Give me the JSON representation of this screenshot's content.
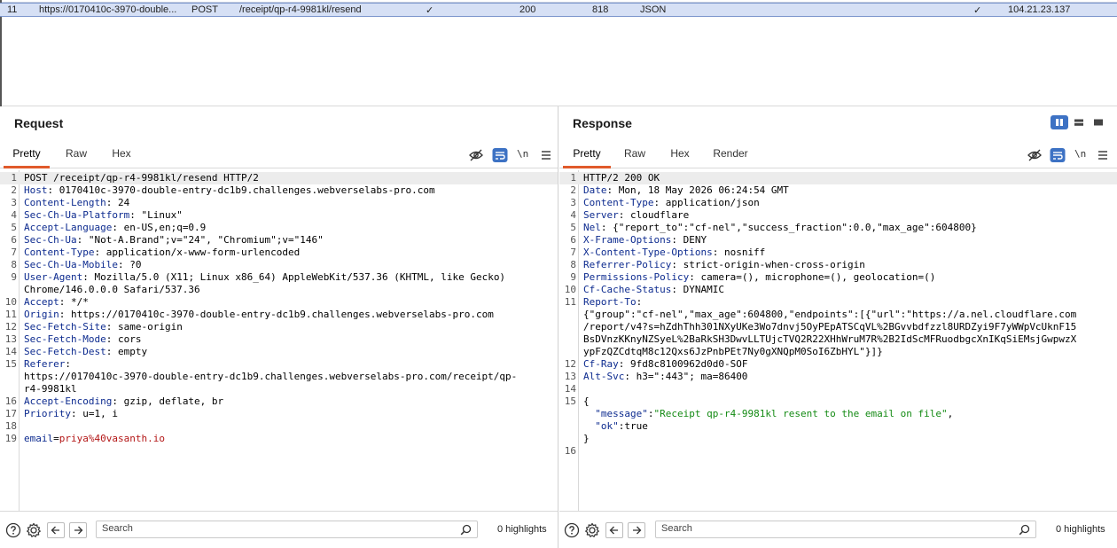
{
  "history": {
    "row": {
      "num": "11",
      "host": "https://0170410c-3970-double...",
      "method": "POST",
      "url": "/receipt/qp-r4-9981kl/resend",
      "params_check": "✓",
      "status": "200",
      "length": "818",
      "mime": "JSON",
      "tls_check": "✓",
      "ip": "104.21.23.137"
    }
  },
  "request": {
    "title": "Request",
    "tabs": [
      "Pretty",
      "Raw",
      "Hex"
    ],
    "newline_label": "\\n",
    "search_placeholder": "Search",
    "highlights": "0 highlights",
    "lines": [
      {
        "n": "1",
        "segs": [
          {
            "t": "POST /receipt/qp-r4-9981kl/resend HTTP/2",
            "c": "v"
          }
        ],
        "hl": true
      },
      {
        "n": "2",
        "segs": [
          {
            "t": "Host",
            "c": "k"
          },
          {
            "t": ": 0170410c-3970-double-entry-dc1b9.challenges.webverselabs-pro.com",
            "c": "v"
          }
        ]
      },
      {
        "n": "3",
        "segs": [
          {
            "t": "Content-Length",
            "c": "k"
          },
          {
            "t": ": 24",
            "c": "v"
          }
        ]
      },
      {
        "n": "4",
        "segs": [
          {
            "t": "Sec-Ch-Ua-Platform",
            "c": "k"
          },
          {
            "t": ": \"Linux\"",
            "c": "v"
          }
        ]
      },
      {
        "n": "5",
        "segs": [
          {
            "t": "Accept-Language",
            "c": "k"
          },
          {
            "t": ": en-US,en;q=0.9",
            "c": "v"
          }
        ]
      },
      {
        "n": "6",
        "segs": [
          {
            "t": "Sec-Ch-Ua",
            "c": "k"
          },
          {
            "t": ": \"Not-A.Brand\";v=\"24\", \"Chromium\";v=\"146\"",
            "c": "v"
          }
        ]
      },
      {
        "n": "7",
        "segs": [
          {
            "t": "Content-Type",
            "c": "k"
          },
          {
            "t": ": application/x-www-form-urlencoded",
            "c": "v"
          }
        ]
      },
      {
        "n": "8",
        "segs": [
          {
            "t": "Sec-Ch-Ua-Mobile",
            "c": "k"
          },
          {
            "t": ": ?0",
            "c": "v"
          }
        ]
      },
      {
        "n": "9",
        "segs": [
          {
            "t": "User-Agent",
            "c": "k"
          },
          {
            "t": ": Mozilla/5.0 (X11; Linux x86_64) AppleWebKit/537.36 (KHTML, like Gecko)",
            "c": "v"
          }
        ]
      },
      {
        "n": "",
        "segs": [
          {
            "t": "Chrome/146.0.0.0 Safari/537.36",
            "c": "v"
          }
        ]
      },
      {
        "n": "10",
        "segs": [
          {
            "t": "Accept",
            "c": "k"
          },
          {
            "t": ": */*",
            "c": "v"
          }
        ]
      },
      {
        "n": "11",
        "segs": [
          {
            "t": "Origin",
            "c": "k"
          },
          {
            "t": ": https://0170410c-3970-double-entry-dc1b9.challenges.webverselabs-pro.com",
            "c": "v"
          }
        ]
      },
      {
        "n": "12",
        "segs": [
          {
            "t": "Sec-Fetch-Site",
            "c": "k"
          },
          {
            "t": ": same-origin",
            "c": "v"
          }
        ]
      },
      {
        "n": "13",
        "segs": [
          {
            "t": "Sec-Fetch-Mode",
            "c": "k"
          },
          {
            "t": ": cors",
            "c": "v"
          }
        ]
      },
      {
        "n": "14",
        "segs": [
          {
            "t": "Sec-Fetch-Dest",
            "c": "k"
          },
          {
            "t": ": empty",
            "c": "v"
          }
        ]
      },
      {
        "n": "15",
        "segs": [
          {
            "t": "Referer",
            "c": "k"
          },
          {
            "t": ":",
            "c": "v"
          }
        ]
      },
      {
        "n": "",
        "segs": [
          {
            "t": "https://0170410c-3970-double-entry-dc1b9.challenges.webverselabs-pro.com/receipt/qp-",
            "c": "v"
          }
        ]
      },
      {
        "n": "",
        "segs": [
          {
            "t": "r4-9981kl",
            "c": "v"
          }
        ]
      },
      {
        "n": "16",
        "segs": [
          {
            "t": "Accept-Encoding",
            "c": "k"
          },
          {
            "t": ": gzip, deflate, br",
            "c": "v"
          }
        ]
      },
      {
        "n": "17",
        "segs": [
          {
            "t": "Priority",
            "c": "k"
          },
          {
            "t": ": u=1, i",
            "c": "v"
          }
        ]
      },
      {
        "n": "18",
        "segs": []
      },
      {
        "n": "19",
        "segs": [
          {
            "t": "email",
            "c": "k"
          },
          {
            "t": "=",
            "c": "v"
          },
          {
            "t": "priya%40vasanth.io",
            "c": "bv"
          }
        ]
      }
    ]
  },
  "response": {
    "title": "Response",
    "tabs": [
      "Pretty",
      "Raw",
      "Hex",
      "Render"
    ],
    "newline_label": "\\n",
    "search_placeholder": "Search",
    "highlights": "0 highlights",
    "lines": [
      {
        "n": "1",
        "segs": [
          {
            "t": "HTTP/2 200 OK",
            "c": "v"
          }
        ],
        "hl": true
      },
      {
        "n": "2",
        "segs": [
          {
            "t": "Date",
            "c": "k"
          },
          {
            "t": ": Mon, 18 May 2026 06:24:54 GMT",
            "c": "v"
          }
        ]
      },
      {
        "n": "3",
        "segs": [
          {
            "t": "Content-Type",
            "c": "k"
          },
          {
            "t": ": application/json",
            "c": "v"
          }
        ]
      },
      {
        "n": "4",
        "segs": [
          {
            "t": "Server",
            "c": "k"
          },
          {
            "t": ": cloudflare",
            "c": "v"
          }
        ]
      },
      {
        "n": "5",
        "segs": [
          {
            "t": "Nel",
            "c": "k"
          },
          {
            "t": ": {\"report_to\":\"cf-nel\",\"success_fraction\":0.0,\"max_age\":604800}",
            "c": "v"
          }
        ]
      },
      {
        "n": "6",
        "segs": [
          {
            "t": "X-Frame-Options",
            "c": "k"
          },
          {
            "t": ": DENY",
            "c": "v"
          }
        ]
      },
      {
        "n": "7",
        "segs": [
          {
            "t": "X-Content-Type-Options",
            "c": "k"
          },
          {
            "t": ": nosniff",
            "c": "v"
          }
        ]
      },
      {
        "n": "8",
        "segs": [
          {
            "t": "Referrer-Policy",
            "c": "k"
          },
          {
            "t": ": strict-origin-when-cross-origin",
            "c": "v"
          }
        ]
      },
      {
        "n": "9",
        "segs": [
          {
            "t": "Permissions-Policy",
            "c": "k"
          },
          {
            "t": ": camera=(), microphone=(), geolocation=()",
            "c": "v"
          }
        ]
      },
      {
        "n": "10",
        "segs": [
          {
            "t": "Cf-Cache-Status",
            "c": "k"
          },
          {
            "t": ": DYNAMIC",
            "c": "v"
          }
        ]
      },
      {
        "n": "11",
        "segs": [
          {
            "t": "Report-To",
            "c": "k"
          },
          {
            "t": ":",
            "c": "v"
          }
        ]
      },
      {
        "n": "",
        "segs": [
          {
            "t": "{\"group\":\"cf-nel\",\"max_age\":604800,\"endpoints\":[{\"url\":\"https://a.nel.cloudflare.com",
            "c": "v"
          }
        ]
      },
      {
        "n": "",
        "segs": [
          {
            "t": "/report/v4?s=hZdhThh301NXyUKe3Wo7dnvj5OyPEpATSCqVL%2BGvvbdfzzl8URDZyi9F7yWWpVcUknF15",
            "c": "v"
          }
        ]
      },
      {
        "n": "",
        "segs": [
          {
            "t": "BsDVnzKKnyNZSyeL%2BaRkSH3DwvLLTUjcTVQ2R22XHhWruM7R%2B2IdScMFRuodbgcXnIKqSiEMsjGwpwzX",
            "c": "v"
          }
        ]
      },
      {
        "n": "",
        "segs": [
          {
            "t": "ypFzQZCdtqM8c12Qxs6JzPnbPEt7Ny0gXNQpM0SoI6ZbHYL\"}]}",
            "c": "v"
          }
        ]
      },
      {
        "n": "12",
        "segs": [
          {
            "t": "Cf-Ray",
            "c": "k"
          },
          {
            "t": ": 9fd8c8100962d0d0-SOF",
            "c": "v"
          }
        ]
      },
      {
        "n": "13",
        "segs": [
          {
            "t": "Alt-Svc",
            "c": "k"
          },
          {
            "t": ": h3=\":443\"; ma=86400",
            "c": "v"
          }
        ]
      },
      {
        "n": "14",
        "segs": []
      },
      {
        "n": "15",
        "segs": [
          {
            "t": "{",
            "c": "v"
          }
        ]
      },
      {
        "n": "",
        "segs": [
          {
            "t": "  \"message\"",
            "c": "js"
          },
          {
            "t": ":",
            "c": "v"
          },
          {
            "t": "\"Receipt qp-r4-9981kl resent to the email on file\"",
            "c": "jv"
          },
          {
            "t": ",",
            "c": "v"
          }
        ]
      },
      {
        "n": "",
        "segs": [
          {
            "t": "  \"ok\"",
            "c": "js"
          },
          {
            "t": ":true",
            "c": "v"
          }
        ]
      },
      {
        "n": "",
        "segs": [
          {
            "t": "}",
            "c": "v"
          }
        ]
      },
      {
        "n": "16",
        "segs": []
      }
    ]
  },
  "colors": {
    "accent": "#e05a2b",
    "selected_row": "#d6e0f5",
    "toggle_blue": "#3d72c4",
    "header_key": "#0d2b8f",
    "json_string": "#138a13",
    "param_value": "#b31616"
  },
  "icons": {
    "hide": "eye-off-icon",
    "wrap": "word-wrap-icon",
    "menu": "hamburger-menu-icon",
    "help": "help-icon",
    "settings": "gear-icon",
    "back": "arrow-left-icon",
    "forward": "arrow-right-icon",
    "search": "search-icon"
  }
}
